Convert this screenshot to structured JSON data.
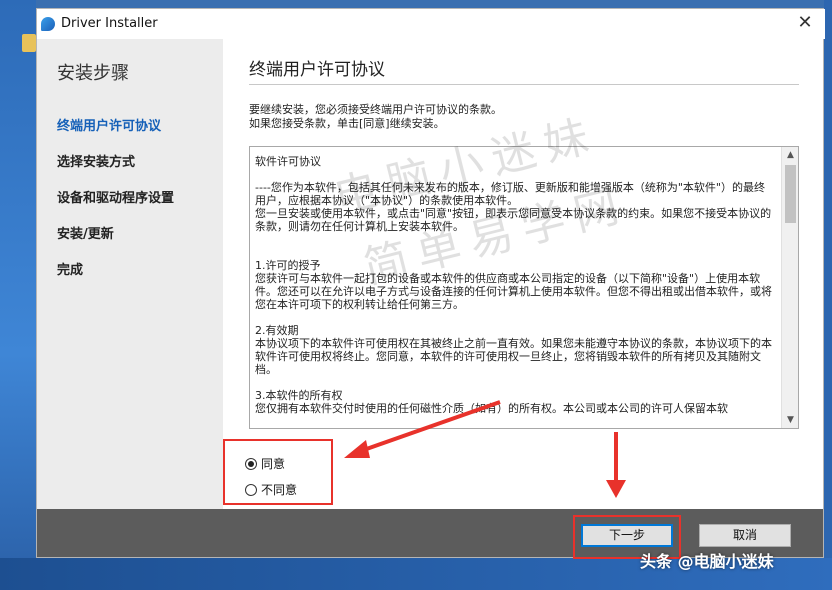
{
  "window": {
    "title": "Driver Installer",
    "close_glyph": "✕"
  },
  "sidebar": {
    "heading": "安装步骤",
    "items": [
      {
        "label": "终端用户许可协议",
        "active": true
      },
      {
        "label": "选择安装方式",
        "active": false
      },
      {
        "label": "设备和驱动程序设置",
        "active": false
      },
      {
        "label": "安装/更新",
        "active": false
      },
      {
        "label": "完成",
        "active": false
      }
    ]
  },
  "main": {
    "title": "终端用户许可协议",
    "intro_line1": "要继续安装，您必须接受终端用户许可协议的条款。",
    "intro_line2": "如果您接受条款，单击[同意]继续安装。",
    "license": {
      "p1": "软件许可协议",
      "p2": "----您作为本软件，包括其任何未来发布的版本，修订版、更新版和能增强版本（统称为\"本软件\"）的最终用户，应根据本协议（\"本协议\"）的条款使用本软件。",
      "p3": "您一旦安装或使用本软件，或点击\"同意\"按钮，即表示您同意受本协议条款的约束。如果您不接受本协议的条款，则请勿在任何计算机上安装本软件。",
      "p4": "1.许可的授予",
      "p5": "您获许可与本软件一起打包的设备或本软件的供应商或本公司指定的设备（以下简称\"设备\"）上使用本软件。您还可以在允许以电子方式与设备连接的任何计算机上使用本软件。但您不得出租或出借本软件，或将您在本许可项下的权利转让给任何第三方。",
      "p6": "2.有效期",
      "p7": "本协议项下的本软件许可使用权在其被终止之前一直有效。如果您未能遵守本协议的条款，本协议项下的本软件许可使用权将终止。您同意，本软件的许可使用权一旦终止，您将销毁本软件的所有拷贝及其随附文档。",
      "p8": "3.本软件的所有权",
      "p9": "您仅拥有本软件交付时使用的任何磁性介质（如有）的所有权。本公司或本公司的许可人保留本软"
    },
    "radio_agree": "同意",
    "radio_disagree": "不同意",
    "agree_selected": true
  },
  "footer": {
    "next_label": "下一步",
    "cancel_label": "取消"
  },
  "overlay": {
    "watermark_line1": "电脑小迷妹",
    "watermark_line2": "简单易学网",
    "credit": "头条 @电脑小迷妹"
  },
  "colors": {
    "annotation_red": "#e8322b",
    "active_step": "#1560b8",
    "footer_bg": "#5c5c5c"
  }
}
